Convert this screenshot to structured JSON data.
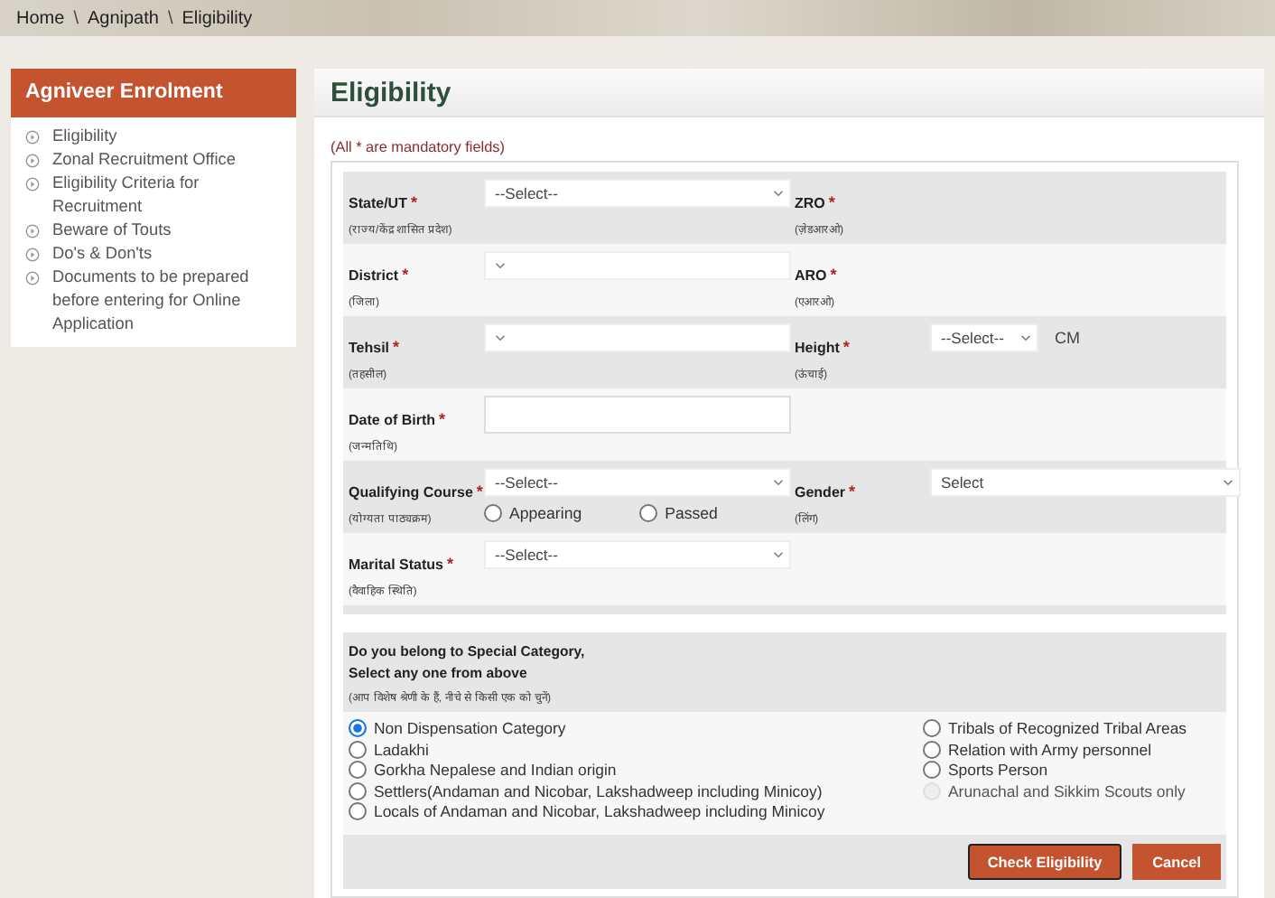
{
  "breadcrumb": [
    "Home",
    "Agnipath",
    "Eligibility"
  ],
  "breadcrumb_separator": "\\",
  "sidebar": {
    "title": "Agniveer Enrolment",
    "items": [
      {
        "label": "Eligibility"
      },
      {
        "label": "Zonal Recruitment Office"
      },
      {
        "label": "Eligibility Criteria for Recruitment"
      },
      {
        "label": "Beware of Touts"
      },
      {
        "label": "Do's & Don'ts"
      },
      {
        "label": "Documents to be prepared before entering for Online Application"
      }
    ]
  },
  "page_title": "Eligibility",
  "mandatory_note": "(All * are mandatory fields)",
  "form_rows": [
    {
      "fields": [
        {
          "label": "State/UT",
          "mark": "*",
          "hint": "(राज्य/केंद्र शासित प्रदेश)",
          "kind": "select",
          "value": "--Select--"
        },
        {
          "label": "ZRO",
          "mark": "*",
          "hint": "(ज़ेडआरओ)",
          "kind": "none"
        }
      ]
    },
    {
      "fields": [
        {
          "label": "District",
          "mark": "*",
          "hint": "(जिला)",
          "kind": "select"
        },
        {
          "label": "ARO",
          "mark": "*",
          "hint": "(एआरओ)",
          "kind": "none"
        }
      ]
    },
    {
      "fields": [
        {
          "label": "Tehsil",
          "mark": "*",
          "hint": "(तहसील)",
          "kind": "select"
        },
        {
          "label": "Height",
          "mark": "*",
          "hint": "(ऊंचाई)",
          "kind": "small_select",
          "value": "--Select--",
          "unit": "CM"
        }
      ]
    },
    {
      "fields": [
        {
          "label": "Date of Birth",
          "mark": "*",
          "hint": "(जन्मतिथि)",
          "kind": "date"
        }
      ]
    },
    {
      "fields": [
        {
          "label": "Qualifying Course",
          "mark": "*",
          "hint": "(योग्यता पाठ्यक्रम)",
          "kind": "select",
          "value": "--Select--",
          "options": [
            {
              "label": "Appearing",
              "selected": false
            },
            {
              "label": "Passed",
              "selected": false
            }
          ]
        },
        {
          "label": "Gender",
          "mark": "*",
          "hint": "(लिंग)",
          "kind": "select",
          "value": "Select"
        }
      ]
    },
    {
      "fields": [
        {
          "label": "Marital Status",
          "mark": "*",
          "hint": "(वैवाहिक स्थिति)",
          "kind": "select",
          "value": "--Select--"
        }
      ]
    }
  ],
  "special_category": {
    "question": "Do you belong to Special Category,",
    "instruction": "Select any one from above",
    "hint": "(आप विशेष श्रेणी के हैं, नीचे से किसी एक को चुनें)",
    "left_options": [
      {
        "label": "Non Dispensation Category",
        "selected": true,
        "disabled": false
      },
      {
        "label": "Ladakhi",
        "selected": false,
        "disabled": false
      },
      {
        "label": "Gorkha Nepalese and Indian origin",
        "selected": false,
        "disabled": false
      },
      {
        "label": "Settlers(Andaman and Nicobar, Lakshadweep including Minicoy)",
        "selected": false,
        "disabled": false
      },
      {
        "label": "Locals of Andaman and Nicobar, Lakshadweep including Minicoy",
        "selected": false,
        "disabled": false
      }
    ],
    "right_options": [
      {
        "label": "Tribals of Recognized Tribal Areas",
        "selected": false,
        "disabled": false
      },
      {
        "label": "Relation with Army personnel",
        "selected": false,
        "disabled": false
      },
      {
        "label": "Sports Person",
        "selected": false,
        "disabled": false
      },
      {
        "label": "Arunachal and Sikkim Scouts only",
        "selected": false,
        "disabled": true
      }
    ]
  },
  "buttons": [
    {
      "label": "Check Eligibility",
      "focused": true
    },
    {
      "label": "Cancel",
      "focused": false
    }
  ]
}
